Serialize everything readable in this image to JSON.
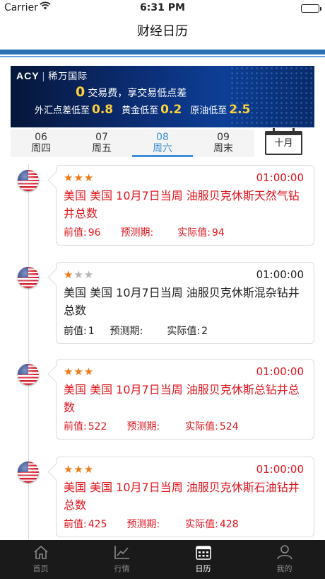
{
  "status": {
    "carrier": "Carrier",
    "time": "6:31 PM"
  },
  "nav": {
    "title": "财经日历"
  },
  "banner": {
    "brand": "ACY",
    "brand_cn": "稀万国际",
    "headline_num": "0",
    "headline_text": "交易费，享交易低点差",
    "fx_label": "外汇点差低至",
    "fx_value": "0.8",
    "gold_label": "黄金低至",
    "gold_value": "0.2",
    "oil_label": "原油低至",
    "oil_value": "2.5"
  },
  "tabs": [
    {
      "date": "06",
      "day": "周四"
    },
    {
      "date": "07",
      "day": "周五"
    },
    {
      "date": "08",
      "day": "周六"
    },
    {
      "date": "09",
      "day": "周末"
    }
  ],
  "active_tab": 2,
  "calendar_button": "十月",
  "events": [
    {
      "stars": 3,
      "time": "01:00:00",
      "title": "美国 美国 10月7日当周 油服贝克休斯天然气钻井总数",
      "prev_label": "前值:",
      "prev": "96",
      "forecast_label": "预测期:",
      "forecast": "",
      "actual_label": "实际值:",
      "actual": "94",
      "highlight": true
    },
    {
      "stars": 1,
      "time": "01:00:00",
      "title": "美国 美国 10月7日当周 油服贝克休斯混杂钻井总数",
      "prev_label": "前值:",
      "prev": "1",
      "forecast_label": "预测期:",
      "forecast": "",
      "actual_label": "实际值:",
      "actual": "2",
      "highlight": false
    },
    {
      "stars": 3,
      "time": "01:00:00",
      "title": "美国 美国 10月7日当周 油服贝克休斯总钻井总数",
      "prev_label": "前值:",
      "prev": "522",
      "forecast_label": "预测期:",
      "forecast": "",
      "actual_label": "实际值:",
      "actual": "524",
      "highlight": true
    },
    {
      "stars": 3,
      "time": "01:00:00",
      "title": "美国 美国 10月7日当周 油服贝克休斯石油钻井总数",
      "prev_label": "前值:",
      "prev": "425",
      "forecast_label": "预测期:",
      "forecast": "",
      "actual_label": "实际值:",
      "actual": "428",
      "highlight": true
    }
  ],
  "tabbar": [
    {
      "label": "首页",
      "icon": "home-icon"
    },
    {
      "label": "行情",
      "icon": "chart-icon"
    },
    {
      "label": "日历",
      "icon": "calendar-icon"
    },
    {
      "label": "我的",
      "icon": "user-icon"
    }
  ],
  "tabbar_active": 2,
  "colors": {
    "accent": "#3a8fd6",
    "nav_bar": "#2c6fb3",
    "important": "#e0141c",
    "star": "#f07a15"
  }
}
